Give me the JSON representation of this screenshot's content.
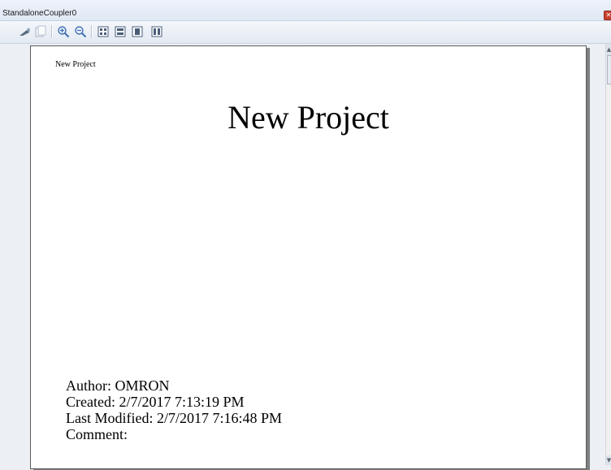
{
  "window": {
    "title": "StandaloneCoupler0"
  },
  "toolbar": {
    "buttons": [
      {
        "icon": "print-icon"
      },
      {
        "icon": "copy-icon"
      },
      {
        "icon": "zoom-in-icon"
      },
      {
        "icon": "zoom-out-icon"
      },
      {
        "icon": "fit-page-icon"
      },
      {
        "icon": "fit-width-icon"
      },
      {
        "icon": "single-page-icon"
      },
      {
        "icon": "two-page-icon"
      }
    ]
  },
  "document": {
    "header": "New Project",
    "title": "New Project",
    "author": "Author: OMRON",
    "created": "Created: 2/7/2017 7:13:19 PM",
    "last_modified": "Last Modified: 2/7/2017 7:16:48 PM",
    "comment": "Comment:"
  },
  "colors": {
    "page_background": "#ffffff",
    "viewer_background": "#eceff3",
    "close_button": "#c8412f"
  }
}
